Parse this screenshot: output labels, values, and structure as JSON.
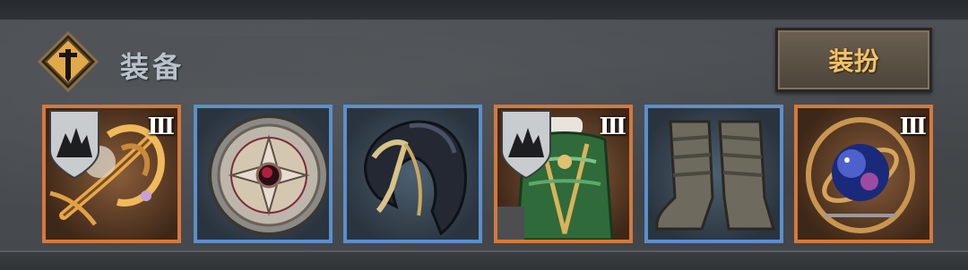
{
  "section": {
    "title": "装备",
    "emblem_icon": "sword-emblem-icon",
    "dress_button_label": "装扮"
  },
  "colors": {
    "orange_frame": "#d4793c",
    "blue_frame": "#5b8fcc",
    "button_text": "#f4c264",
    "title_text": "#b9c2cb"
  },
  "equipment_slots": [
    {
      "item": "golden-staff",
      "icon": "staff-icon",
      "frame": "orange",
      "tier": "III",
      "shield_badge": true
    },
    {
      "item": "round-shield",
      "icon": "shield-icon",
      "frame": "blue",
      "tier": "",
      "shield_badge": false
    },
    {
      "item": "dark-hood",
      "icon": "hood-icon",
      "frame": "blue",
      "tier": "",
      "shield_badge": false
    },
    {
      "item": "green-armor",
      "icon": "armor-icon",
      "frame": "orange",
      "tier": "III",
      "shield_badge": true
    },
    {
      "item": "wrapped-boots",
      "icon": "boots-icon",
      "frame": "blue",
      "tier": "",
      "shield_badge": false
    },
    {
      "item": "cosmic-orb",
      "icon": "orb-icon",
      "frame": "orange",
      "tier": "III",
      "shield_badge": false
    }
  ]
}
